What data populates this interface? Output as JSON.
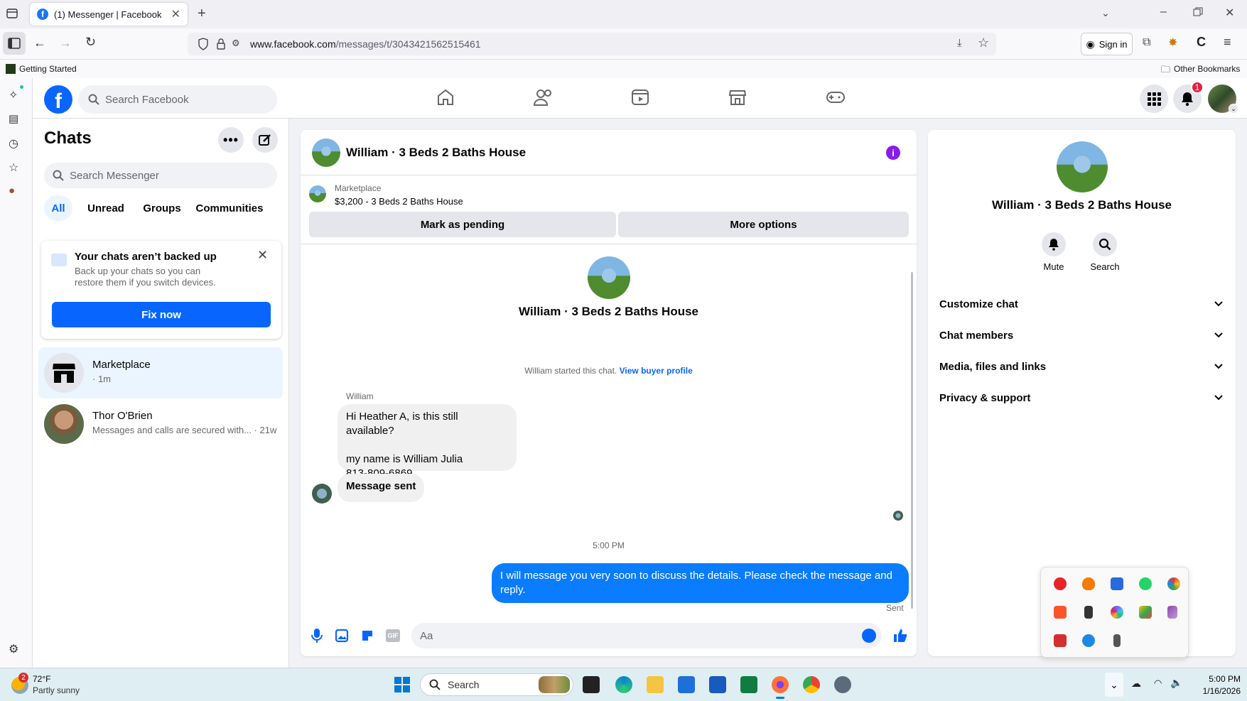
{
  "browser": {
    "tab_title": "(1) Messenger | Facebook",
    "url_host": "www.facebook.com",
    "url_path": "/messages/t/3043421562515461",
    "sign_in": "Sign in",
    "bookmark_left": "Getting Started",
    "bookmark_right": "Other Bookmarks"
  },
  "fb_top": {
    "search_placeholder": "Search Facebook",
    "notification_count": "1"
  },
  "chats": {
    "title": "Chats",
    "search_placeholder": "Search Messenger",
    "filters": [
      "All",
      "Unread",
      "Groups",
      "Communities"
    ],
    "backup": {
      "title": "Your chats aren’t backed up",
      "body": "Back up your chats so you can restore them if you switch devices.",
      "button": "Fix now"
    },
    "items": [
      {
        "name": "Marketplace",
        "preview": "· 1m"
      },
      {
        "name": "Thor O'Brien",
        "preview": "Messages and calls are secured with... · 21w"
      }
    ]
  },
  "conversation": {
    "title": "William · 3 Beds 2 Baths House",
    "listing_source": "Marketplace",
    "listing_text": "$3,200 - 3 Beds 2 Baths House",
    "mark_pending": "Mark as pending",
    "more_options": "More options",
    "hero_title": "William · 3 Beds 2 Baths House",
    "started_text": "William started this chat.",
    "view_profile": "View buyer profile",
    "sender_name": "William",
    "msg1_line1": "Hi Heather A, is this still available?",
    "msg1_line2": "my name is William Julia",
    "msg1_line3": "813-809-6869",
    "msg2": "Message sent",
    "timestamp": "5:00 PM",
    "my_msg": "I will message you very soon to discuss the details. Please check the message and reply.",
    "status": "Sent",
    "composer_placeholder": "Aa"
  },
  "info_panel": {
    "title": "William · 3 Beds 2 Baths House",
    "mute": "Mute",
    "search": "Search",
    "sections": [
      "Customize chat",
      "Chat members",
      "Media, files and links",
      "Privacy & support"
    ]
  },
  "taskbar": {
    "temp": "72°F",
    "weather": "Partly sunny",
    "weather_badge": "2",
    "search": "Search",
    "time": "5:00 PM",
    "date": "1/16/2026"
  },
  "colors": {
    "fb_blue": "#0866ff",
    "bubble_blue": "#0a7cff",
    "badge_red": "#e41e3f"
  }
}
